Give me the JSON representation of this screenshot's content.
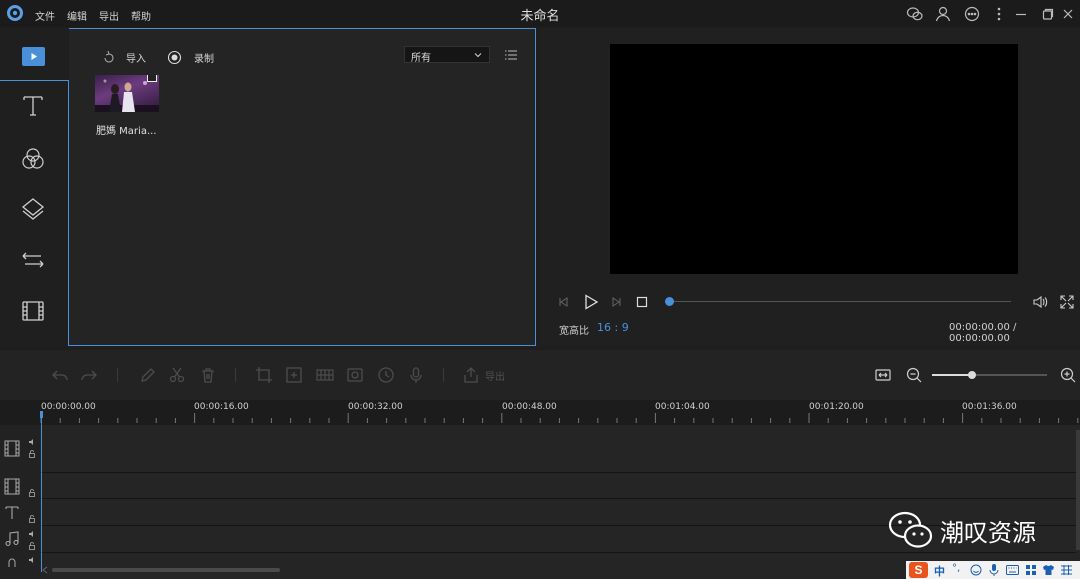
{
  "window": {
    "title": "未命名"
  },
  "menu": {
    "file": "文件",
    "edit": "编辑",
    "export": "导出",
    "help": "帮助"
  },
  "media": {
    "import_label": "导入",
    "record_label": "录制",
    "filter_value": "所有",
    "items": [
      {
        "name": "肥媽 Maria..."
      }
    ]
  },
  "preview": {
    "aspect_label": "宽高比",
    "aspect_value": "16 : 9",
    "time_display": "00:00:00.00 / 00:00:00.00",
    "progress": 0
  },
  "timeline": {
    "export_label": "导出",
    "zoom_level": 0.35,
    "ruler_labels": [
      "00:00:00.00",
      "00:00:16.00",
      "00:00:32.00",
      "00:00:48.00",
      "00:01:04.00",
      "00:01:20.00",
      "00:01:36.00"
    ]
  },
  "watermark": {
    "text": "潮叹资源"
  },
  "ime": {
    "mode": "中"
  },
  "colors": {
    "accent": "#4a90d9",
    "panel": "#242424",
    "background": "#1e1e1e"
  }
}
